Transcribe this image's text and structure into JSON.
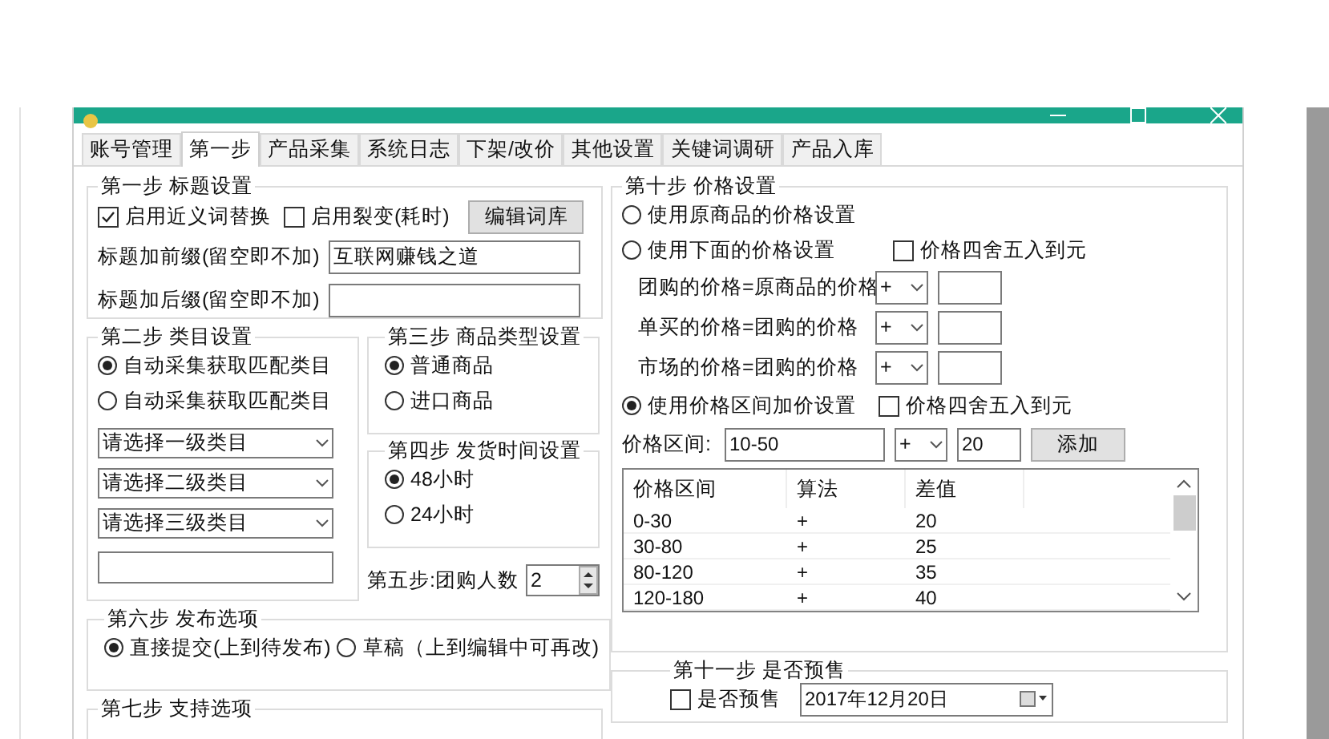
{
  "tabs": [
    {
      "label": "账号管理",
      "selected": false
    },
    {
      "label": "第一步",
      "selected": true
    },
    {
      "label": "产品采集",
      "selected": false
    },
    {
      "label": "系统日志",
      "selected": false
    },
    {
      "label": "下架/改价",
      "selected": false
    },
    {
      "label": "其他设置",
      "selected": false
    },
    {
      "label": "关键词调研",
      "selected": false
    },
    {
      "label": "产品入库",
      "selected": false
    }
  ],
  "title_settings": {
    "legend": "第一步 标题设置",
    "checkboxes": [
      {
        "label": "启用近义词替换",
        "checked": true
      },
      {
        "label": "启用裂变(耗时)",
        "checked": false
      }
    ],
    "edit_button": "编辑词库",
    "prefix": {
      "label": "标题加前缀(留空即不加)",
      "value": "互联网赚钱之道"
    },
    "suffix": {
      "label": "标题加后缀(留空即不加)"
    }
  },
  "category": {
    "legend": "第二步 类目设置",
    "options": [
      {
        "label": "自动采集获取匹配类目",
        "selected": true
      },
      {
        "label": "自动采集获取匹配类目",
        "selected": false
      }
    ],
    "selects": [
      "请选择一级类目",
      "请选择二级类目",
      "请选择三级类目"
    ]
  },
  "product_type": {
    "legend": "第三步 商品类型设置",
    "options": [
      {
        "label": "普通商品",
        "selected": true
      },
      {
        "label": "进口商品",
        "selected": false
      }
    ]
  },
  "shipping": {
    "legend": "第四步 发货时间设置",
    "options": [
      {
        "label": "48小时",
        "selected": true
      },
      {
        "label": "24小时",
        "selected": false
      }
    ]
  },
  "group_buy": {
    "label": "第五步:团购人数",
    "value": "2"
  },
  "publish": {
    "legend": "第六步 发布选项",
    "options": [
      {
        "label": "直接提交(上到待发布)",
        "selected": true
      },
      {
        "label": "草稿（上到编辑中可再改)",
        "selected": false
      }
    ]
  },
  "support": {
    "legend": "第七步 支持选项"
  },
  "price": {
    "legend": "第十步 价格设置",
    "modes": [
      {
        "label": "使用原商品的价格设置",
        "selected": false
      },
      {
        "label": "使用下面的价格设置",
        "selected": false
      },
      {
        "label": "使用价格区间加价设置",
        "selected": true
      }
    ],
    "rounding": [
      {
        "label": "价格四舍五入到元",
        "checked": false
      },
      {
        "label": "价格四舍五入到元",
        "checked": false
      }
    ],
    "formulas": [
      {
        "label": "团购的价格=原商品的价格",
        "operator": "+"
      },
      {
        "label": "单买的价格=团购的价格",
        "operator": "+"
      },
      {
        "label": "市场的价格=团购的价格",
        "operator": "+"
      }
    ],
    "range": {
      "label": "价格区间:",
      "value": "10-50",
      "operator": "+",
      "amount": "20",
      "button": "添加"
    },
    "table": {
      "columns": [
        "价格区间",
        "算法",
        "差值"
      ],
      "rows": [
        [
          "0-30",
          "+",
          "20"
        ],
        [
          "30-80",
          "+",
          "25"
        ],
        [
          "80-120",
          "+",
          "35"
        ],
        [
          "120-180",
          "+",
          "40"
        ]
      ]
    }
  },
  "presale": {
    "legend": "第十一步 是否预售",
    "checkbox": {
      "label": "是否预售",
      "checked": false
    },
    "date": "2017年12月20日"
  }
}
